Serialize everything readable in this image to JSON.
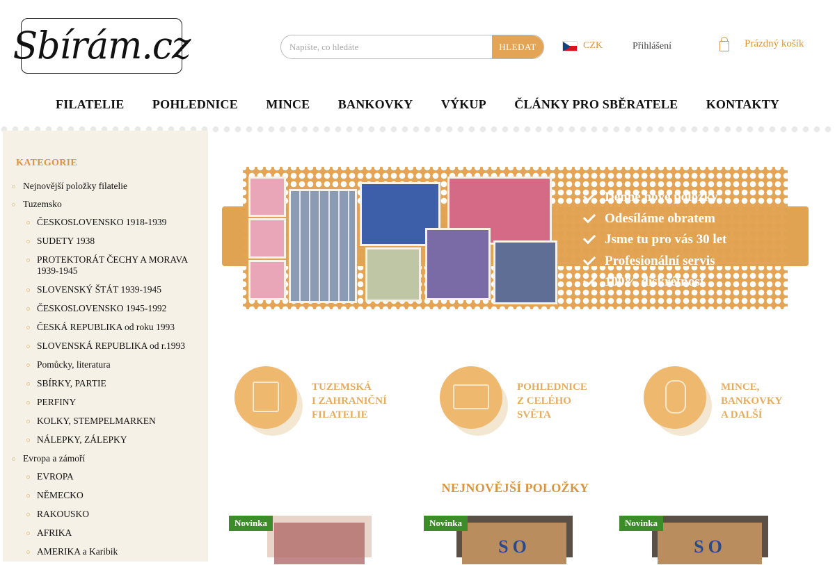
{
  "header": {
    "logo_text": "Sbírám.cz",
    "search_placeholder": "Napište, co hledáte",
    "search_button": "HLEDAT",
    "currency": "CZK",
    "login": "Přihlášení",
    "cart": "Prázdný košík"
  },
  "nav": [
    "FILATELIE",
    "POHLEDNICE",
    "MINCE",
    "BANKOVKY",
    "VÝKUP",
    "ČLÁNKY PRO SBĚRATELE",
    "KONTAKTY"
  ],
  "sidebar": {
    "title": "KATEGORIE",
    "items": [
      {
        "label": "Nejnovější položky filatelie",
        "level": 0
      },
      {
        "label": "Tuzemsko",
        "level": 0
      },
      {
        "label": "ČESKOSLOVENSKO 1918-1939",
        "level": 1
      },
      {
        "label": "SUDETY 1938",
        "level": 1
      },
      {
        "label": "PROTEKTORÁT ČECHY A MORAVA 1939-1945",
        "level": 1
      },
      {
        "label": "SLOVENSKÝ ŠTÁT 1939-1945",
        "level": 1
      },
      {
        "label": "ČESKOSLOVENSKO 1945-1992",
        "level": 1
      },
      {
        "label": "ČESKÁ REPUBLIKA od roku 1993",
        "level": 1
      },
      {
        "label": "SLOVENSKÁ REPUBLIKA od r.1993",
        "level": 1
      },
      {
        "label": "Pomůcky, literatura",
        "level": 1
      },
      {
        "label": "SBÍRKY, PARTIE",
        "level": 1
      },
      {
        "label": "PERFINY",
        "level": 1
      },
      {
        "label": "KOLKY, STEMPELMARKEN",
        "level": 1
      },
      {
        "label": "NÁLEPKY, ZÁLEPKY",
        "level": 1
      },
      {
        "label": "Evropa a zámoří",
        "level": 0
      },
      {
        "label": "EVROPA",
        "level": 1
      },
      {
        "label": "NĚMECKO",
        "level": 1
      },
      {
        "label": "RAKOUSKO",
        "level": 1
      },
      {
        "label": "AFRIKA",
        "level": 1
      },
      {
        "label": "AMERIKA a Karibik",
        "level": 1
      }
    ]
  },
  "banner": {
    "checks": [
      "Denně nové položky",
      "Odesíláme obratem",
      "Jsme tu pro vás 30 let",
      "Profesionální servis",
      "100% diskrétnost"
    ]
  },
  "features": [
    {
      "lines": [
        "TUZEMSKÁ",
        "I ZAHRANIČNÍ",
        "FILATELIE"
      ],
      "icon": "stamp-icon"
    },
    {
      "lines": [
        "POHLEDNICE",
        "Z CELÉHO",
        "SVĚTA"
      ],
      "icon": "postcard-icon"
    },
    {
      "lines": [
        "MINCE,",
        "BANKOVKY",
        "A DALŠÍ"
      ],
      "icon": "coins-icon"
    }
  ],
  "latest": {
    "title": "NEJNOVĚJŠÍ POLOŽKY",
    "products": [
      {
        "badge": "Novinka",
        "image_text": ""
      },
      {
        "badge": "Novinka",
        "image_text": "SO"
      },
      {
        "badge": "Novinka",
        "image_text": "SO"
      }
    ]
  },
  "colors": {
    "accent": "#d9953f",
    "banner": "#e3a555",
    "sidebar_bg": "#f6f1e6",
    "badge": "#3d8c2a"
  }
}
